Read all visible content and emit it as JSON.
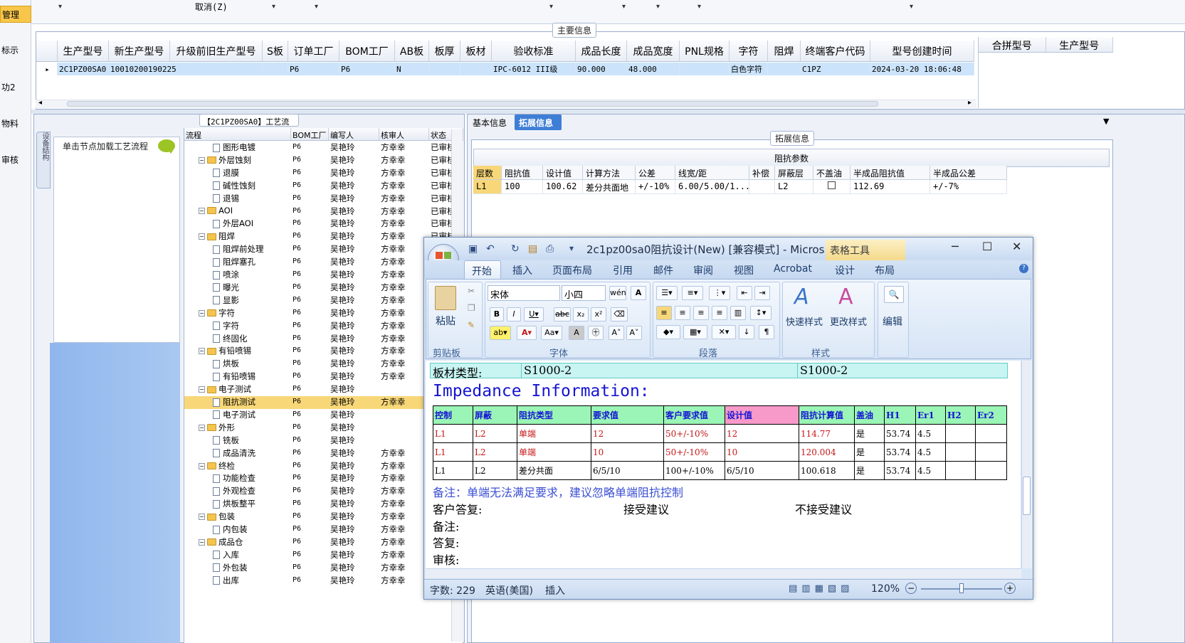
{
  "left_strip": {
    "selected": "管理",
    "items": [
      "标示",
      "功2",
      "物料",
      "审核"
    ]
  },
  "toolbar": {
    "cancel_label": "取消(Z)"
  },
  "main_info": {
    "title": "主要信息",
    "columns": [
      "生产型号",
      "新生产型号",
      "升级前旧生产型号",
      "S板",
      "订单工厂",
      "BOM工厂",
      "AB板",
      "板厚",
      "板材",
      "验收标准",
      "成品长度",
      "成品宽度",
      "PNL规格",
      "字符",
      "阻焊",
      "终端客户代码",
      "型号创建时间"
    ],
    "row": [
      "2C1PZ00SA0",
      "10010200190225",
      "",
      "",
      "P6",
      "P6",
      "N",
      "",
      "",
      "IPC-6012 III级",
      "90.000",
      "48.000",
      "",
      "白色字符",
      "",
      "C1PZ",
      "2024-03-20 18:06:48"
    ],
    "side_columns": [
      "合拼型号",
      "生产型号"
    ]
  },
  "process": {
    "title": "【2C1PZ00SA0】工艺流程",
    "vertical_tab": "设备结构",
    "node_hint": "单击节点加载工艺流程",
    "columns": [
      "流程",
      "BOM工厂",
      "编写人",
      "核审人",
      "状态"
    ],
    "rows": [
      {
        "name": "图形电镀",
        "level": 2,
        "folder": false,
        "bom": "P6",
        "writer": "吴艳玲",
        "reviewer": "方幸幸",
        "status": "已审核"
      },
      {
        "name": "外层蚀刻",
        "level": 1,
        "folder": true,
        "bom": "P6",
        "writer": "吴艳玲",
        "reviewer": "方幸幸",
        "status": "已审核"
      },
      {
        "name": "退膜",
        "level": 2,
        "folder": false,
        "bom": "P6",
        "writer": "吴艳玲",
        "reviewer": "方幸幸",
        "status": "已审核"
      },
      {
        "name": "碱性蚀刻",
        "level": 2,
        "folder": false,
        "bom": "P6",
        "writer": "吴艳玲",
        "reviewer": "方幸幸",
        "status": "已审核"
      },
      {
        "name": "退锡",
        "level": 2,
        "folder": false,
        "bom": "P6",
        "writer": "吴艳玲",
        "reviewer": "方幸幸",
        "status": "已审核"
      },
      {
        "name": "AOI",
        "level": 1,
        "folder": true,
        "bom": "P6",
        "writer": "吴艳玲",
        "reviewer": "方幸幸",
        "status": "已审核"
      },
      {
        "name": "外层AOI",
        "level": 2,
        "folder": false,
        "bom": "P6",
        "writer": "吴艳玲",
        "reviewer": "方幸幸",
        "status": "已审核"
      },
      {
        "name": "阻焊",
        "level": 1,
        "folder": true,
        "bom": "P6",
        "writer": "吴艳玲",
        "reviewer": "方幸幸",
        "status": "已审核"
      },
      {
        "name": "阻焊前处理",
        "level": 2,
        "folder": false,
        "bom": "P6",
        "writer": "吴艳玲",
        "reviewer": "方幸幸",
        "status": ""
      },
      {
        "name": "阻焊塞孔",
        "level": 2,
        "folder": false,
        "bom": "P6",
        "writer": "吴艳玲",
        "reviewer": "方幸幸",
        "status": ""
      },
      {
        "name": "喷涂",
        "level": 2,
        "folder": false,
        "bom": "P6",
        "writer": "吴艳玲",
        "reviewer": "方幸幸",
        "status": ""
      },
      {
        "name": "曝光",
        "level": 2,
        "folder": false,
        "bom": "P6",
        "writer": "吴艳玲",
        "reviewer": "方幸幸",
        "status": ""
      },
      {
        "name": "显影",
        "level": 2,
        "folder": false,
        "bom": "P6",
        "writer": "吴艳玲",
        "reviewer": "方幸幸",
        "status": ""
      },
      {
        "name": "字符",
        "level": 1,
        "folder": true,
        "bom": "P6",
        "writer": "吴艳玲",
        "reviewer": "方幸幸",
        "status": ""
      },
      {
        "name": "字符",
        "level": 2,
        "folder": false,
        "bom": "P6",
        "writer": "吴艳玲",
        "reviewer": "方幸幸",
        "status": ""
      },
      {
        "name": "终固化",
        "level": 2,
        "folder": false,
        "bom": "P6",
        "writer": "吴艳玲",
        "reviewer": "方幸幸",
        "status": ""
      },
      {
        "name": "有铅喷锡",
        "level": 1,
        "folder": true,
        "bom": "P6",
        "writer": "吴艳玲",
        "reviewer": "方幸幸",
        "status": ""
      },
      {
        "name": "烘板",
        "level": 2,
        "folder": false,
        "bom": "P6",
        "writer": "吴艳玲",
        "reviewer": "方幸幸",
        "status": ""
      },
      {
        "name": "有铅喷锡",
        "level": 2,
        "folder": false,
        "bom": "P6",
        "writer": "吴艳玲",
        "reviewer": "方幸幸",
        "status": ""
      },
      {
        "name": "电子测试",
        "level": 1,
        "folder": true,
        "bom": "P6",
        "writer": "吴艳玲",
        "reviewer": "",
        "status": ""
      },
      {
        "name": "阻抗测试",
        "level": 2,
        "folder": false,
        "bom": "P6",
        "writer": "吴艳玲",
        "reviewer": "方幸幸",
        "status": "",
        "highlight": true
      },
      {
        "name": "电子测试",
        "level": 2,
        "folder": false,
        "bom": "P6",
        "writer": "吴艳玲",
        "reviewer": "",
        "status": ""
      },
      {
        "name": "外形",
        "level": 1,
        "folder": true,
        "bom": "P6",
        "writer": "吴艳玲",
        "reviewer": "",
        "status": ""
      },
      {
        "name": "铣板",
        "level": 2,
        "folder": false,
        "bom": "P6",
        "writer": "吴艳玲",
        "reviewer": "",
        "status": ""
      },
      {
        "name": "成品清洗",
        "level": 2,
        "folder": false,
        "bom": "P6",
        "writer": "吴艳玲",
        "reviewer": "方幸幸",
        "status": ""
      },
      {
        "name": "终检",
        "level": 1,
        "folder": true,
        "bom": "P6",
        "writer": "吴艳玲",
        "reviewer": "方幸幸",
        "status": ""
      },
      {
        "name": "功能检查",
        "level": 2,
        "folder": false,
        "bom": "P6",
        "writer": "吴艳玲",
        "reviewer": "方幸幸",
        "status": ""
      },
      {
        "name": "外观检查",
        "level": 2,
        "folder": false,
        "bom": "P6",
        "writer": "吴艳玲",
        "reviewer": "方幸幸",
        "status": ""
      },
      {
        "name": "烘板整平",
        "level": 2,
        "folder": false,
        "bom": "P6",
        "writer": "吴艳玲",
        "reviewer": "方幸幸",
        "status": ""
      },
      {
        "name": "包装",
        "level": 1,
        "folder": true,
        "bom": "P6",
        "writer": "吴艳玲",
        "reviewer": "方幸幸",
        "status": ""
      },
      {
        "name": "内包装",
        "level": 2,
        "folder": false,
        "bom": "P6",
        "writer": "吴艳玲",
        "reviewer": "方幸幸",
        "status": ""
      },
      {
        "name": "成品仓",
        "level": 1,
        "folder": true,
        "bom": "P6",
        "writer": "吴艳玲",
        "reviewer": "方幸幸",
        "status": ""
      },
      {
        "name": "入库",
        "level": 2,
        "folder": false,
        "bom": "P6",
        "writer": "吴艳玲",
        "reviewer": "方幸幸",
        "status": ""
      },
      {
        "name": "外包装",
        "level": 2,
        "folder": false,
        "bom": "P6",
        "writer": "吴艳玲",
        "reviewer": "方幸幸",
        "status": ""
      },
      {
        "name": "出库",
        "level": 2,
        "folder": false,
        "bom": "P6",
        "writer": "吴艳玲",
        "reviewer": "方幸幸",
        "status": ""
      }
    ]
  },
  "right_panel": {
    "tabs": [
      "基本信息",
      "拓展信息"
    ],
    "ext_title": "拓展信息",
    "impedance_title": "阻抗参数",
    "imp_columns": [
      "层数",
      "阻抗值",
      "设计值",
      "计算方法",
      "公差",
      "线宽/距",
      "补偿",
      "屏蔽层",
      "不盖油",
      "半成品阻抗值",
      "半成品公差"
    ],
    "imp_row": [
      "L1",
      "100",
      "100.62",
      "差分共面地",
      "+/-10%",
      "6.00/5.00/1...",
      "",
      "L2",
      "",
      "112.69",
      "+/-7%"
    ]
  },
  "word": {
    "title": "2c1pz00sa0阻抗设计(New) [兼容模式] - Micros...",
    "table_tools": "表格工具",
    "tabs": [
      "开始",
      "插入",
      "页面布局",
      "引用",
      "邮件",
      "审阅",
      "视图",
      "Acrobat",
      "设计",
      "布局"
    ],
    "font_name": "宋体",
    "font_size": "小四",
    "groups": {
      "clipboard": "剪贴板",
      "font": "字体",
      "paragraph": "段落",
      "styles": "样式"
    },
    "paste": "粘贴",
    "quick_styles": "快速样式",
    "change_styles": "更改样式",
    "edit": "编辑",
    "board_label": "板材类型:",
    "board_val1": "S1000-2",
    "board_val2": "S1000-2",
    "impedance_heading": "Impedance Information:",
    "doc_headers": [
      "控制",
      "屏蔽",
      "阻抗类型",
      "要求值",
      "客户要求值",
      "设计值",
      "阻抗计算值",
      "盖油",
      "H1",
      "Er1",
      "H2",
      "Er2"
    ],
    "doc_rows": [
      [
        "L1",
        "L2",
        "单端",
        "12",
        "50+/-10%",
        "12",
        "114.77",
        "是",
        "53.74",
        "4.5",
        "",
        ""
      ],
      [
        "L1",
        "L2",
        "单端",
        "10",
        "50+/-10%",
        "10",
        "120.004",
        "是",
        "53.74",
        "4.5",
        "",
        ""
      ],
      [
        "L1",
        "L2",
        "差分共面",
        "6/5/10",
        "100+/-10%",
        "6/5/10",
        "100.618",
        "是",
        "53.74",
        "4.5",
        "",
        ""
      ]
    ],
    "note": "备注：单端无法满足要求，建议忽略单端阻抗控制",
    "customer_reply": "客户答复:",
    "accept": "接受建议",
    "reject": "不接受建议",
    "remark": "备注:",
    "reply": "答复:",
    "review": "审核:",
    "status_words": "字数: 229",
    "status_lang": "英语(美国)",
    "status_mode": "插入",
    "zoom": "120%"
  }
}
